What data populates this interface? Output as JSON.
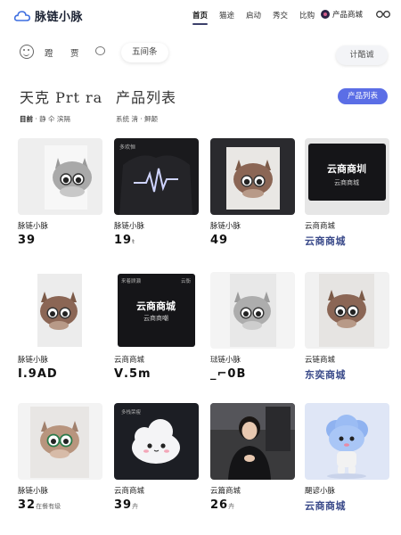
{
  "brand": {
    "name": "脉链小脉"
  },
  "nav": {
    "items": [
      "首页",
      "猫途",
      "启动",
      "秀交",
      "比购"
    ],
    "active_index": 0,
    "mall_label": "产品商城"
  },
  "toolbar": {
    "label_1": "蹬",
    "label_2": "贾",
    "days_pill": "五间条",
    "ghost_button": "计酷诚"
  },
  "section": {
    "left_title": "天克 Prt ra",
    "left_sub_bold": "目前",
    "left_sub_rest": "· 静 仐 滨隔",
    "mid_title": "产品列表",
    "mid_sub": "系统 淸 · 魻颠",
    "primary_button": "产品列表"
  },
  "products": [
    {
      "name": "脉链小脉",
      "price": "39",
      "price_suffix": "",
      "thumb": "cat-gray-light"
    },
    {
      "name": "脉链小脉",
      "price": "19",
      "price_suffix": "ŧ",
      "thumb": "black-tee-pulse"
    },
    {
      "name": "脉链小脉",
      "price": "49",
      "price_suffix": "",
      "thumb": "cat-brown-dark"
    },
    {
      "name": "云商商城",
      "price": "云商商城",
      "price_suffix": "",
      "thumb": "black-card-yunshang"
    },
    {
      "name": "脉链小脉",
      "price": "I.9AD",
      "price_suffix": "",
      "thumb": "cat-brown-poster"
    },
    {
      "name": "云商商城",
      "price": "Ⅴ.5m",
      "price_suffix": "",
      "thumb": "black-phone-yunshang"
    },
    {
      "name": "琺链小脉",
      "price": "_⌐0B",
      "price_suffix": "",
      "thumb": "cat-gray-poster"
    },
    {
      "name": "云链商城",
      "price": "东奕商城",
      "price_suffix": "",
      "thumb": "cat-brown-poster-2"
    },
    {
      "name": "脉链小脉",
      "price": "32",
      "price_suffix": "在餐有级",
      "thumb": "cat-glasses"
    },
    {
      "name": "云商商城",
      "price": "39",
      "price_suffix": "卉",
      "thumb": "cloud-mascot"
    },
    {
      "name": "云篇商城",
      "price": "26",
      "price_suffix": "卉",
      "thumb": "woman-photo"
    },
    {
      "name": "颶谚小脉",
      "price": "云商商城",
      "price_suffix": "",
      "thumb": "blue-mascot"
    }
  ],
  "thumb_text": {
    "tee_label": "多欢恒",
    "card_title": "云商商圳",
    "card_sub": "云商商城",
    "phone_top_left": "来着顾瀬",
    "phone_top_right": "云衡",
    "phone_title": "云商商城",
    "phone_sub": "云商商嘲",
    "cloud_label": "多栈荣瘦"
  },
  "colors": {
    "accent": "#5b6ee6",
    "nav_underline": "#3b3f6a",
    "text_dark": "#1b2233",
    "price_blue": "#3a4a8a"
  }
}
